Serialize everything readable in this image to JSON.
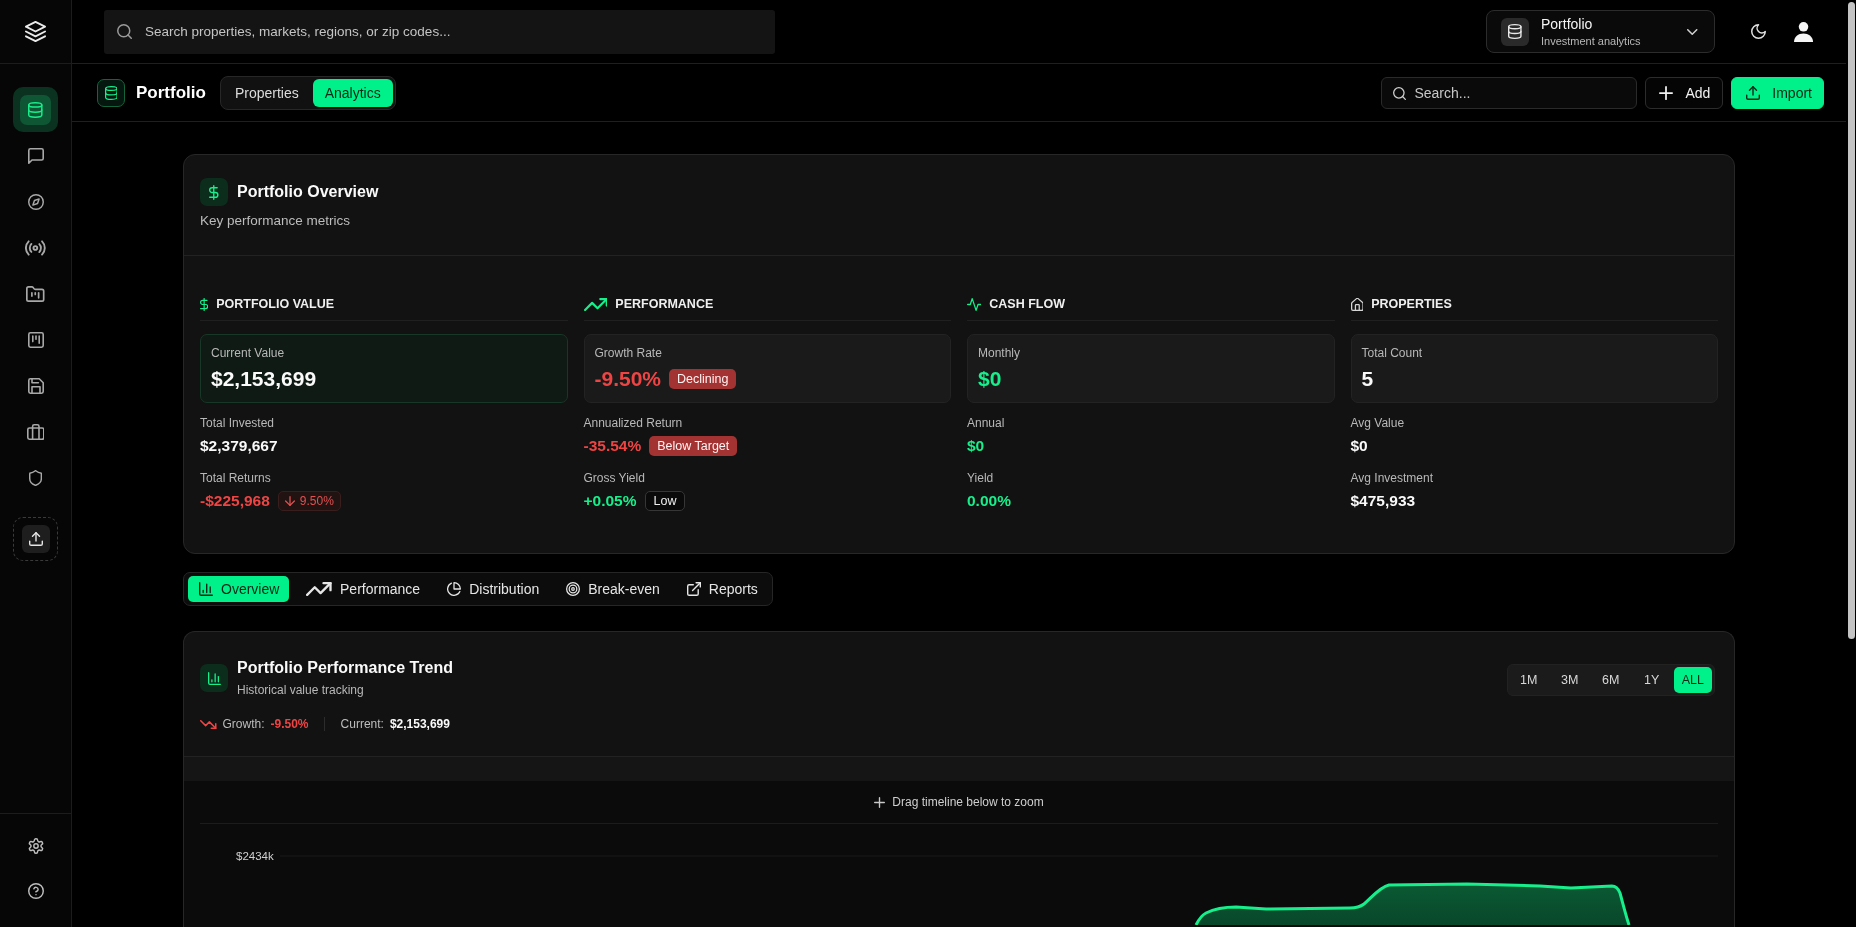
{
  "sidebar": {
    "items": [
      {
        "selected": true
      },
      {
        "selected": false
      },
      {
        "selected": false
      },
      {
        "selected": false
      },
      {
        "selected": false
      },
      {
        "selected": false
      },
      {
        "selected": false
      },
      {
        "selected": false
      },
      {
        "selected": false
      }
    ]
  },
  "top_bar": {
    "search": {
      "placeholder": "Search properties, markets, regions, or zip codes..."
    },
    "workspace": {
      "title": "Portfolio",
      "subtitle": "Investment analytics"
    }
  },
  "page_header": {
    "title": "Portfolio",
    "tabs": [
      {
        "label": "Properties",
        "selected": false
      },
      {
        "label": "Analytics",
        "selected": true
      }
    ],
    "search": {
      "placeholder": "Search..."
    },
    "buttons": [
      {
        "label": "Add",
        "kind": "secondary"
      },
      {
        "label": "Import",
        "kind": "primary"
      }
    ]
  },
  "overview": {
    "title": "Portfolio Overview",
    "subtitle": "Key performance metrics",
    "sections": [
      {
        "title": "PORTFOLIO VALUE",
        "highlight": {
          "label": "Current Value",
          "value": "$2,153,699",
          "color": "#fafafa",
          "emphasized": true
        },
        "metrics": [
          {
            "label": "Total Invested",
            "value": "$2,379,667",
            "color": "#fafafa"
          },
          {
            "label": "Total Returns",
            "value": "-$225,968",
            "color": "#ef4444",
            "badge": {
              "text": "9.50%",
              "kind": "decrease"
            }
          }
        ]
      },
      {
        "title": "PERFORMANCE",
        "highlight": {
          "label": "Growth Rate",
          "value": "-9.50%",
          "color": "#ef4444",
          "emphasized": false,
          "badge": {
            "text": "Declining",
            "kind": "alert"
          }
        },
        "metrics": [
          {
            "label": "Annualized Return",
            "value": "-35.54%",
            "color": "#ef4444",
            "badge": {
              "text": "Below Target",
              "kind": "alert"
            }
          },
          {
            "label": "Gross Yield",
            "value": "+0.05%",
            "color": "#16ef8b",
            "badge": {
              "text": "Low",
              "kind": "outline"
            }
          }
        ]
      },
      {
        "title": "CASH FLOW",
        "highlight": {
          "label": "Monthly",
          "value": "$0",
          "color": "#16ef8b",
          "emphasized": false
        },
        "metrics": [
          {
            "label": "Annual",
            "value": "$0",
            "color": "#16ef8b"
          },
          {
            "label": "Yield",
            "value": "0.00%",
            "color": "#16ef8b"
          }
        ]
      },
      {
        "title": "PROPERTIES",
        "highlight": {
          "label": "Total Count",
          "value": "5",
          "color": "#fafafa",
          "emphasized": false
        },
        "metrics": [
          {
            "label": "Avg Value",
            "value": "$0",
            "color": "#fafafa"
          },
          {
            "label": "Avg Investment",
            "value": "$475,933",
            "color": "#fafafa"
          }
        ]
      }
    ]
  },
  "analysis_tabs": [
    {
      "label": "Overview",
      "selected": true
    },
    {
      "label": "Performance",
      "selected": false
    },
    {
      "label": "Distribution",
      "selected": false
    },
    {
      "label": "Break-even",
      "selected": false
    },
    {
      "label": "Reports",
      "selected": false
    }
  ],
  "trend_chart": {
    "title": "Portfolio Performance Trend",
    "subtitle": "Historical value tracking",
    "stats": [
      {
        "label": "Growth:",
        "value": "-9.50%",
        "color": "#ef4444"
      },
      {
        "label": "Current:",
        "value": "$2,153,699",
        "color": "#fafafa"
      }
    ],
    "ranges": [
      {
        "label": "1M",
        "selected": false
      },
      {
        "label": "3M",
        "selected": false
      },
      {
        "label": "6M",
        "selected": false
      },
      {
        "label": "1Y",
        "selected": false
      },
      {
        "label": "ALL",
        "selected": true
      }
    ],
    "hint": "Drag timeline below to zoom",
    "y_axis_label": "$2434k"
  }
}
